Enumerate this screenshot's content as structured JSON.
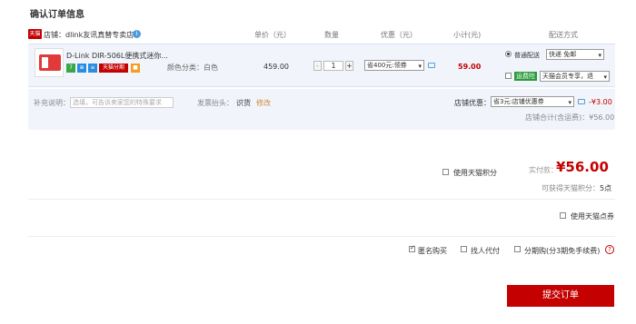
{
  "page_title": "确认订单信息",
  "columns": {
    "unit_price": "单价（元）",
    "quantity": "数量",
    "discount": "优惠（元）",
    "subtotal": "小计(元)",
    "shipping": "配送方式"
  },
  "store": {
    "badge": "天猫",
    "label": "店铺：dlink友讯真替专卖店",
    "info_icon": "i"
  },
  "item": {
    "name": "D-Link DIR-506L便携式迷你...",
    "badges": [
      {
        "text": "7",
        "color": "#3aa648"
      },
      {
        "text": "⊕",
        "color": "#2a8de0"
      },
      {
        "text": "≡",
        "color": "#2a8de0"
      },
      {
        "text": "天猫分期",
        "color": "#c40000"
      },
      {
        "text": "■",
        "color": "#f0a020"
      }
    ],
    "spec_label": "颜色分类：白色",
    "unit_price": "459.00",
    "quantity": "1",
    "qty_minus": "-",
    "qty_plus": "+",
    "discount_select": "省400元:领券",
    "subtotal": "59.00",
    "shipping_option_label": "普通配送",
    "shipping_select": "快递 免邮",
    "freight_insurance_label": "运费险",
    "freight_insurance_select": "天猫会员专享，退"
  },
  "extras": {
    "note_label": "补充说明：",
    "note_placeholder": "选填，可告诉卖家您的特殊要求",
    "invoice_label": "发票抬头：",
    "invoice_value": "识货",
    "invoice_edit": "修改",
    "store_discount_label": "店铺优惠：",
    "store_discount_select": "省3元:店铺优惠券",
    "store_discount_value": "-¥3.00",
    "store_total": "店铺合计(含运费)：¥56.00"
  },
  "summary": {
    "use_points_label": "使用天猫积分",
    "paid_label": "实付款：",
    "paid_value": "¥56.00",
    "points_earned": "可获得天猫积分：",
    "points_value": "5点",
    "use_coupon_points_label": "使用天猫点券"
  },
  "options": {
    "anonymous_label": "匿名购买",
    "friend_pay_label": "找人代付",
    "installment_label": "分期购(分3期免手续费)",
    "help_icon": "?"
  },
  "submit_label": "提交订单",
  "colors": {
    "accent_red": "#c40000",
    "row_bg": "#f1f5fb"
  }
}
